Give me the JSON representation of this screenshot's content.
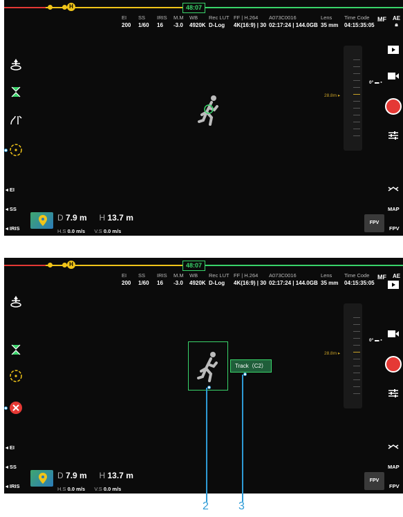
{
  "timer": "48:07",
  "h_badge": "H",
  "params": [
    {
      "label": "EI",
      "value": "200"
    },
    {
      "label": "SS",
      "value": "1/60"
    },
    {
      "label": "IRIS",
      "value": "16"
    },
    {
      "label": "M.M",
      "value": "-3.0"
    },
    {
      "label": "WB",
      "value": "4920K"
    },
    {
      "label": "Rec LUT",
      "value": "D-Log"
    },
    {
      "label": "FF | H.264",
      "value": "4K(16:9) | 30"
    },
    {
      "label": "A073C0016",
      "value": "02:17:24 | 144.0GB"
    },
    {
      "label": "Lens",
      "value": "35 mm"
    },
    {
      "label": "Time Code",
      "value": "04:15:35:05"
    }
  ],
  "mf": "MF",
  "ae": "AE",
  "side_labels": {
    "ei": "EI",
    "ss": "SS",
    "iris": "IRIS"
  },
  "right_labels": {
    "map": "MAP",
    "fpv": "FPV"
  },
  "fpv_button": "FPV",
  "altitude_marker": "28.8m",
  "zero_marker": "0°",
  "telemetry": {
    "d_label": "D",
    "d_value": "7.9 m",
    "h_label": "H",
    "h_value": "13.7 m",
    "hs_label": "H.S",
    "hs_value": "0.0 m/s",
    "vs_label": "V.S",
    "vs_value": "0.0 m/s"
  },
  "track_label": "Track（C2）",
  "callouts": [
    "2",
    "3"
  ],
  "colors": {
    "accent_green": "#39d46a",
    "record_red": "#e53935",
    "callout_blue": "#2e9bd6",
    "warning_yellow": "#f0c419"
  }
}
